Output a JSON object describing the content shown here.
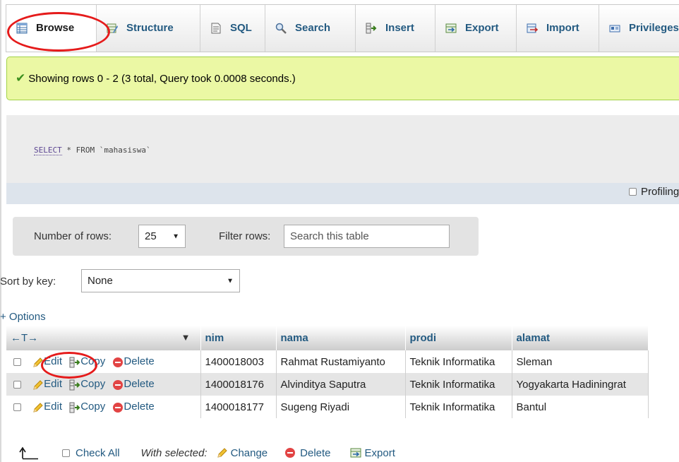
{
  "tabs": [
    {
      "label": "Browse",
      "icon": "browse-icon",
      "active": true
    },
    {
      "label": "Structure",
      "icon": "structure-icon"
    },
    {
      "label": "SQL",
      "icon": "sql-icon"
    },
    {
      "label": "Search",
      "icon": "search-icon"
    },
    {
      "label": "Insert",
      "icon": "insert-icon"
    },
    {
      "label": "Export",
      "icon": "export-icon"
    },
    {
      "label": "Import",
      "icon": "import-icon"
    },
    {
      "label": "Privileges",
      "icon": "privileges-icon"
    }
  ],
  "message": {
    "text": "Showing rows 0 - 2 (3 total, Query took 0.0008 seconds.)",
    "color_bg": "#ebf8a4",
    "color_border": "#a2d246"
  },
  "sql": {
    "kw_select": "SELECT",
    "star": " * ",
    "kw_from": "FROM",
    "table": " `mahasiswa`"
  },
  "profiling": {
    "label": "Profiling"
  },
  "nav": {
    "rows_label": "Number of rows:",
    "rows_value": "25",
    "filter_label": "Filter rows:",
    "filter_placeholder": "Search this table"
  },
  "sort": {
    "label": "Sort by key:",
    "value": "None"
  },
  "options_label": "+ Options",
  "table": {
    "columns": [
      "nim",
      "nama",
      "prodi",
      "alamat"
    ],
    "actions": {
      "edit": "Edit",
      "copy": "Copy",
      "delete": "Delete"
    },
    "rows": [
      {
        "nim": "1400018003",
        "nama": "Rahmat Rustamiyanto",
        "prodi": "Teknik Informatika",
        "alamat": "Sleman"
      },
      {
        "nim": "1400018176",
        "nama": "Alvinditya Saputra",
        "prodi": "Teknik Informatika",
        "alamat": "Yogyakarta Hadiningrat"
      },
      {
        "nim": "1400018177",
        "nama": "Sugeng Riyadi",
        "prodi": "Teknik Informatika",
        "alamat": "Bantul"
      }
    ]
  },
  "bottom": {
    "check_all": "Check All",
    "with_selected": "With selected:",
    "change": "Change",
    "delete": "Delete",
    "export": "Export"
  },
  "colors": {
    "link": "#235a81",
    "annotation": "#e51b1b"
  }
}
